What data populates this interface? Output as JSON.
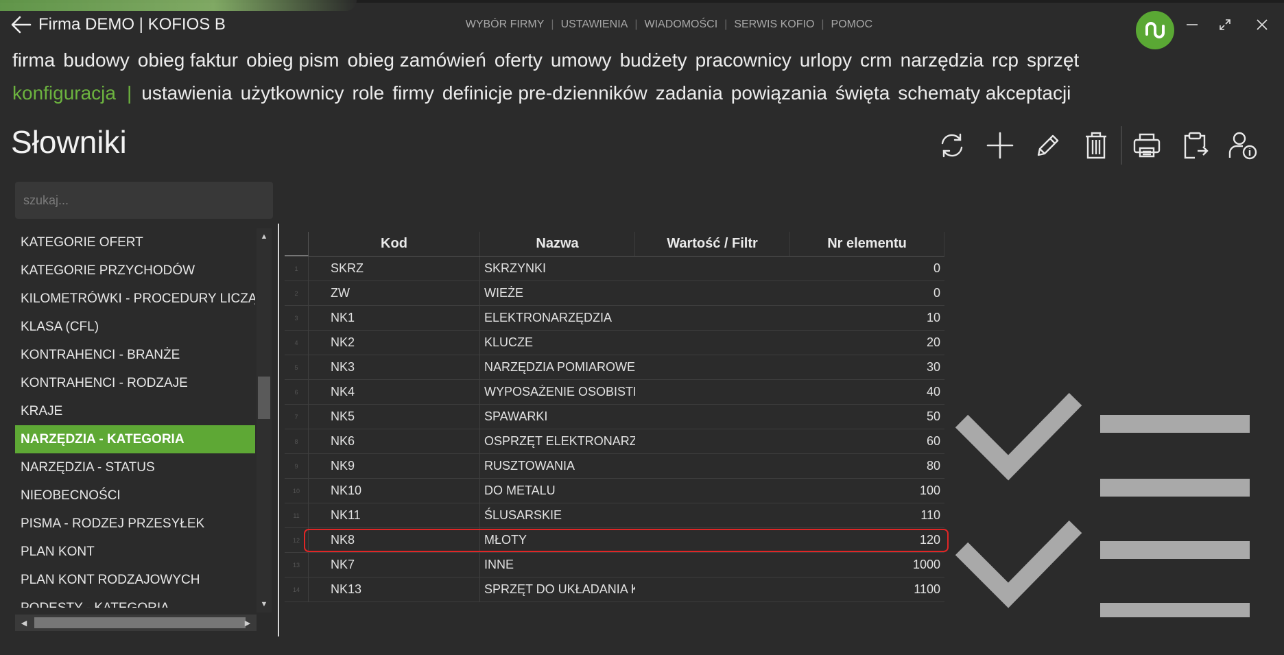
{
  "window": {
    "title": "Firma DEMO | KOFIOS B",
    "top_links": [
      "WYBÓR FIRMY",
      "USTAWIENIA",
      "WIADOMOŚCI",
      "SERWIS KOFIO",
      "POMOC"
    ]
  },
  "menu": {
    "main": [
      "firma",
      "budowy",
      "obieg faktur",
      "obieg pism",
      "obieg zamówień",
      "oferty",
      "umowy",
      "budżety",
      "pracownicy",
      "urlopy",
      "crm",
      "narzędzia",
      "rcp",
      "sprzęt"
    ],
    "section_label": "konfiguracja",
    "section_divider": "|",
    "sub": [
      "ustawienia",
      "użytkownicy",
      "role",
      "firmy",
      "definicje pre-dzienników",
      "zadania",
      "powiązania",
      "święta",
      "schematy akceptacji"
    ]
  },
  "page": {
    "title": "Słowniki"
  },
  "toolbar": [
    "refresh-icon",
    "add-icon",
    "edit-icon",
    "delete-icon",
    "print-icon",
    "clipboard-export-icon",
    "user-info-icon"
  ],
  "search": {
    "placeholder": "szukaj...",
    "value": ""
  },
  "dictionary_list": {
    "items": [
      "KATEGORIE OFERT",
      "KATEGORIE PRZYCHODÓW",
      "KILOMETRÓWKI - PROCEDURY LICZĄCE",
      "KLASA (CFL)",
      "KONTRAHENCI - BRANŻE",
      "KONTRAHENCI - RODZAJE",
      "KRAJE",
      "NARZĘDZIA - KATEGORIA",
      "NARZĘDZIA - STATUS",
      "NIEOBECNOŚCI",
      "PISMA - RODZEJ PRZESYŁEK",
      "PLAN KONT",
      "PLAN KONT RODZAJOWYCH",
      "PODESTY - KATEGORIA"
    ],
    "selected": "NARZĘDZIA - KATEGORIA"
  },
  "grid": {
    "columns": [
      "Kod",
      "Nazwa",
      "Wartość / Filtr",
      "Nr elementu"
    ],
    "rows": [
      {
        "n": "1",
        "kod": "SKRZ",
        "nazwa": "SKRZYNKI",
        "wartosc": "",
        "nr": "0"
      },
      {
        "n": "2",
        "kod": "ZW",
        "nazwa": "WIEŻE",
        "wartosc": "",
        "nr": "0"
      },
      {
        "n": "3",
        "kod": "NK1",
        "nazwa": "ELEKTRONARZĘDZIA",
        "wartosc": "",
        "nr": "10"
      },
      {
        "n": "4",
        "kod": "NK2",
        "nazwa": "KLUCZE",
        "wartosc": "",
        "nr": "20"
      },
      {
        "n": "5",
        "kod": "NK3",
        "nazwa": "NARZĘDZIA POMIAROWE",
        "wartosc": "",
        "nr": "30"
      },
      {
        "n": "6",
        "kod": "NK4",
        "nazwa": "WYPOSAŻENIE OSOBISTE",
        "wartosc": "",
        "nr": "40"
      },
      {
        "n": "7",
        "kod": "NK5",
        "nazwa": "SPAWARKI",
        "wartosc": "",
        "nr": "50"
      },
      {
        "n": "8",
        "kod": "NK6",
        "nazwa": "OSPRZĘT ELEKTRONARZĘDZ",
        "wartosc": "",
        "nr": "60"
      },
      {
        "n": "9",
        "kod": "NK9",
        "nazwa": "RUSZTOWANIA",
        "wartosc": "",
        "nr": "80"
      },
      {
        "n": "10",
        "kod": "NK10",
        "nazwa": "DO METALU",
        "wartosc": "",
        "nr": "100"
      },
      {
        "n": "11",
        "kod": "NK11",
        "nazwa": "ŚLUSARSKIE",
        "wartosc": "",
        "nr": "110"
      },
      {
        "n": "12",
        "kod": "NK8",
        "nazwa": "MŁOTY",
        "wartosc": "",
        "nr": "120"
      },
      {
        "n": "13",
        "kod": "NK7",
        "nazwa": "INNE",
        "wartosc": "",
        "nr": "1000"
      },
      {
        "n": "14",
        "kod": "NK13",
        "nazwa": "SPRZĘT DO UKŁADANIA KA",
        "wartosc": "",
        "nr": "1100"
      }
    ],
    "highlighted_kod": "NK8"
  },
  "colors": {
    "accent": "#5ea835",
    "highlight_border": "#e02626",
    "background": "#2b2b2b"
  },
  "decoration": {
    "icon": "checklist-icon"
  }
}
